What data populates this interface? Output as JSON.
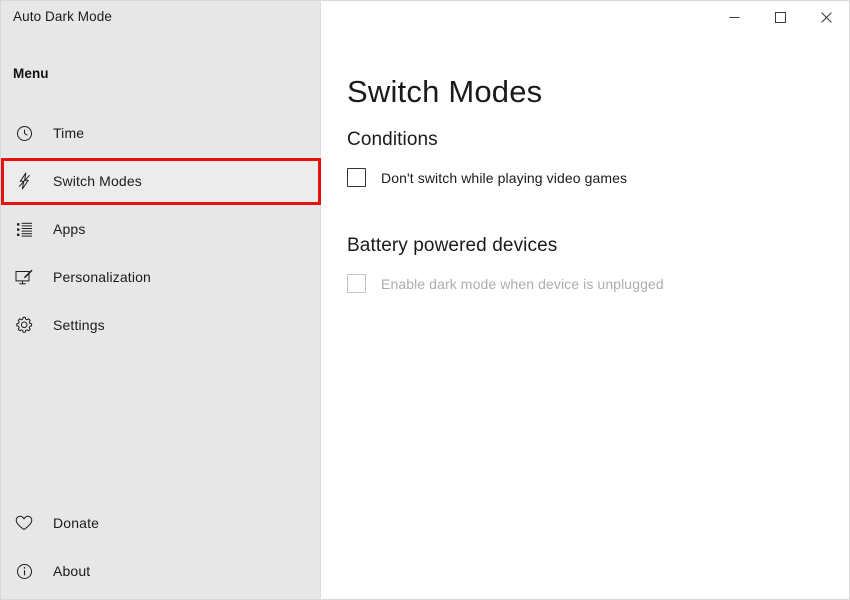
{
  "window": {
    "title": "Auto Dark Mode",
    "controls": [
      {
        "name": "minimize",
        "label": "–"
      },
      {
        "name": "maximize",
        "label": "□"
      },
      {
        "name": "close",
        "label": "✕"
      }
    ]
  },
  "sidebar": {
    "header": "Menu",
    "items": [
      {
        "label": "Time",
        "icon": "clock-icon",
        "selected": false
      },
      {
        "label": "Switch Modes",
        "icon": "lightning-slash-icon",
        "selected": true
      },
      {
        "label": "Apps",
        "icon": "list-icon",
        "selected": false
      },
      {
        "label": "Personalization",
        "icon": "monitor-pen-icon",
        "selected": false
      },
      {
        "label": "Settings",
        "icon": "gear-icon",
        "selected": false
      }
    ],
    "bottom_items": [
      {
        "label": "Donate",
        "icon": "heart-icon",
        "selected": false
      },
      {
        "label": "About",
        "icon": "info-circle-icon",
        "selected": false
      }
    ]
  },
  "main": {
    "page_title": "Switch Modes",
    "sections": [
      {
        "title": "Conditions",
        "options": [
          {
            "label": "Don't switch while playing video games",
            "checked": false,
            "disabled": false
          }
        ]
      },
      {
        "title": "Battery powered devices",
        "options": [
          {
            "label": "Enable dark mode when device is unplugged",
            "checked": false,
            "disabled": true
          }
        ]
      }
    ]
  },
  "annotation": {
    "target": "Switch Modes",
    "color": "#e8120c"
  },
  "colors": {
    "sidebar_bg": "#e7e7e7",
    "sidebar_selected_bg": "#ececec",
    "content_bg": "#ffffff",
    "selection_indicator": "#4a5a78",
    "text": "#1b1b1b",
    "disabled_text": "#adadad",
    "annotation_red": "#e8120c"
  }
}
